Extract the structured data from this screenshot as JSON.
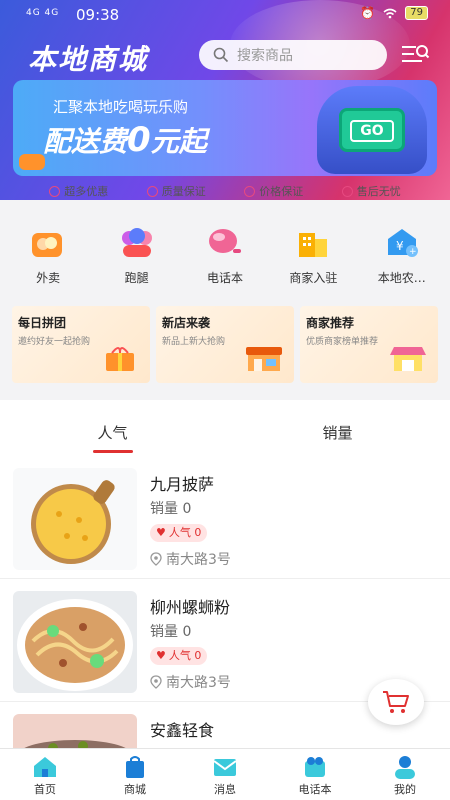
{
  "status_bar": {
    "signal": "4G 4G",
    "time": "09:38",
    "battery": "79"
  },
  "header": {
    "title": "本地商城",
    "search_placeholder": "搜索商品"
  },
  "banner": {
    "line1": "汇聚本地吃喝玩乐购",
    "line2_prefix": "配送费",
    "line2_zero": "0",
    "line2_suffix": "元起",
    "button": "GO"
  },
  "guarantees": [
    "超多优惠",
    "质量保证",
    "价格保证",
    "售后无忧"
  ],
  "categories": [
    {
      "label": "外卖",
      "icon": "takeout-icon"
    },
    {
      "label": "跑腿",
      "icon": "errand-icon"
    },
    {
      "label": "电话本",
      "icon": "phonebook-icon"
    },
    {
      "label": "商家入驻",
      "icon": "merchant-join-icon"
    },
    {
      "label": "本地农…",
      "icon": "local-farm-icon"
    }
  ],
  "promos": [
    {
      "title": "每日拼团",
      "subtitle": "邀约好友一起抢购"
    },
    {
      "title": "新店来袭",
      "subtitle": "新品上新大抢购"
    },
    {
      "title": "商家推荐",
      "subtitle": "优质商家榜单推荐"
    }
  ],
  "tabs": [
    {
      "label": "人气"
    },
    {
      "label": "销量"
    }
  ],
  "products": [
    {
      "name": "九月披萨",
      "sales": "销量 0",
      "popularity": "人气 0",
      "address": "南大路3号"
    },
    {
      "name": "柳州螺蛳粉",
      "sales": "销量 0",
      "popularity": "人气 0",
      "address": "南大路3号"
    },
    {
      "name": "安鑫轻食",
      "sales": "",
      "popularity": "",
      "address": ""
    }
  ],
  "tabbar": [
    {
      "label": "首页",
      "icon": "home-icon"
    },
    {
      "label": "商城",
      "icon": "shop-bag-icon"
    },
    {
      "label": "消息",
      "icon": "message-icon"
    },
    {
      "label": "电话本",
      "icon": "phonebook-icon"
    },
    {
      "label": "我的",
      "icon": "profile-icon"
    }
  ],
  "colors": {
    "accent": "#e03131",
    "header_start": "#3b5bdb",
    "header_end": "#f06595",
    "tab_icon": "#1c9bb3"
  }
}
